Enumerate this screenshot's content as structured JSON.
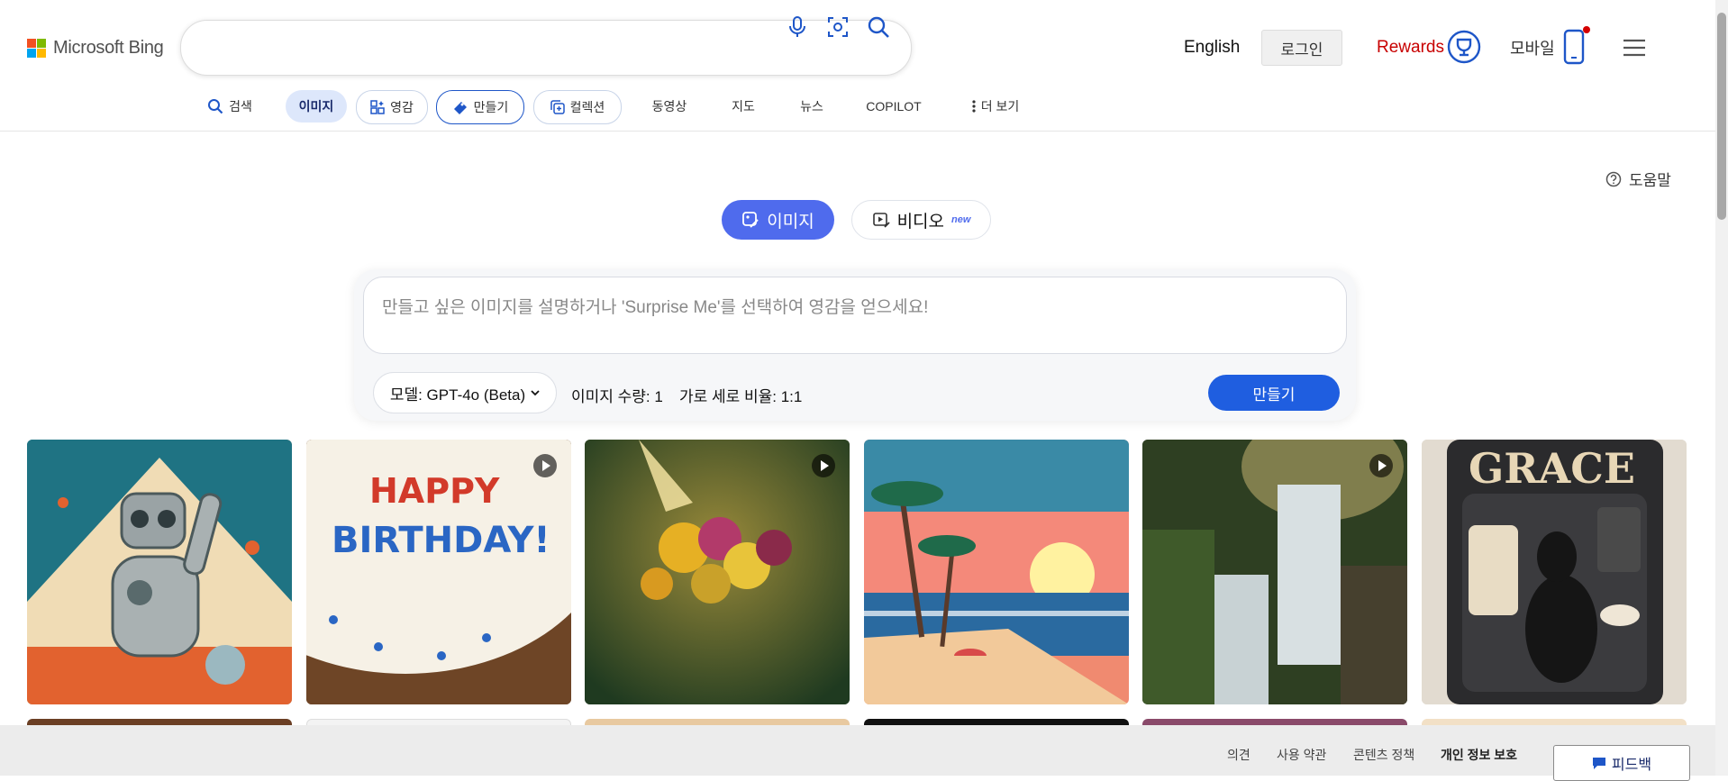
{
  "header": {
    "logo_text": "Microsoft Bing",
    "search_value": "",
    "language": "English",
    "login_label": "로그인",
    "rewards_label": "Rewards",
    "mobile_label": "모바일"
  },
  "nav": {
    "items": [
      {
        "label": "검색",
        "icon": "search-icon"
      },
      {
        "label": "이미지"
      },
      {
        "label": "영감",
        "icon": "inspiration-icon"
      },
      {
        "label": "만들기",
        "icon": "create-icon"
      },
      {
        "label": "컬렉션",
        "icon": "collections-icon"
      },
      {
        "label": "동영상"
      },
      {
        "label": "지도"
      },
      {
        "label": "뉴스"
      },
      {
        "label": "COPILOT"
      },
      {
        "label": "더 보기",
        "icon": "more-vertical-icon"
      }
    ]
  },
  "help_label": "도움말",
  "tabs": {
    "image_label": "이미지",
    "video_label": "비디오",
    "video_badge": "new"
  },
  "create": {
    "prompt_placeholder": "만들고 싶은 이미지를 설명하거나 'Surprise Me'를 선택하여 영감을 얻으세요!",
    "model_label": "모델: GPT-4o (Beta)",
    "image_count": "이미지 수량: 1",
    "aspect_ratio": "가로 세로 비율: 1:1",
    "create_button": "만들기"
  },
  "gallery": [
    {
      "name": "retro-robot-image",
      "video": false,
      "caption": ""
    },
    {
      "name": "happy-birthday-cake-image",
      "video": true,
      "caption": "HAPPY BIRTHDAY!"
    },
    {
      "name": "hummingbird-flowers-image",
      "video": true,
      "caption": ""
    },
    {
      "name": "pixel-beach-sunset-image",
      "video": false,
      "caption": ""
    },
    {
      "name": "waterfall-forest-image",
      "video": true,
      "caption": ""
    },
    {
      "name": "grace-dog-box-image",
      "video": false,
      "caption": "GRACE"
    }
  ],
  "footer": {
    "links": [
      "의견",
      "사용 약관",
      "콘텐츠 정책",
      "개인 정보 보호"
    ],
    "feedback_label": "피드백"
  },
  "colors": {
    "accent": "#4f6bed",
    "create_button": "#1f5ee0",
    "rewards": "#c80000"
  }
}
